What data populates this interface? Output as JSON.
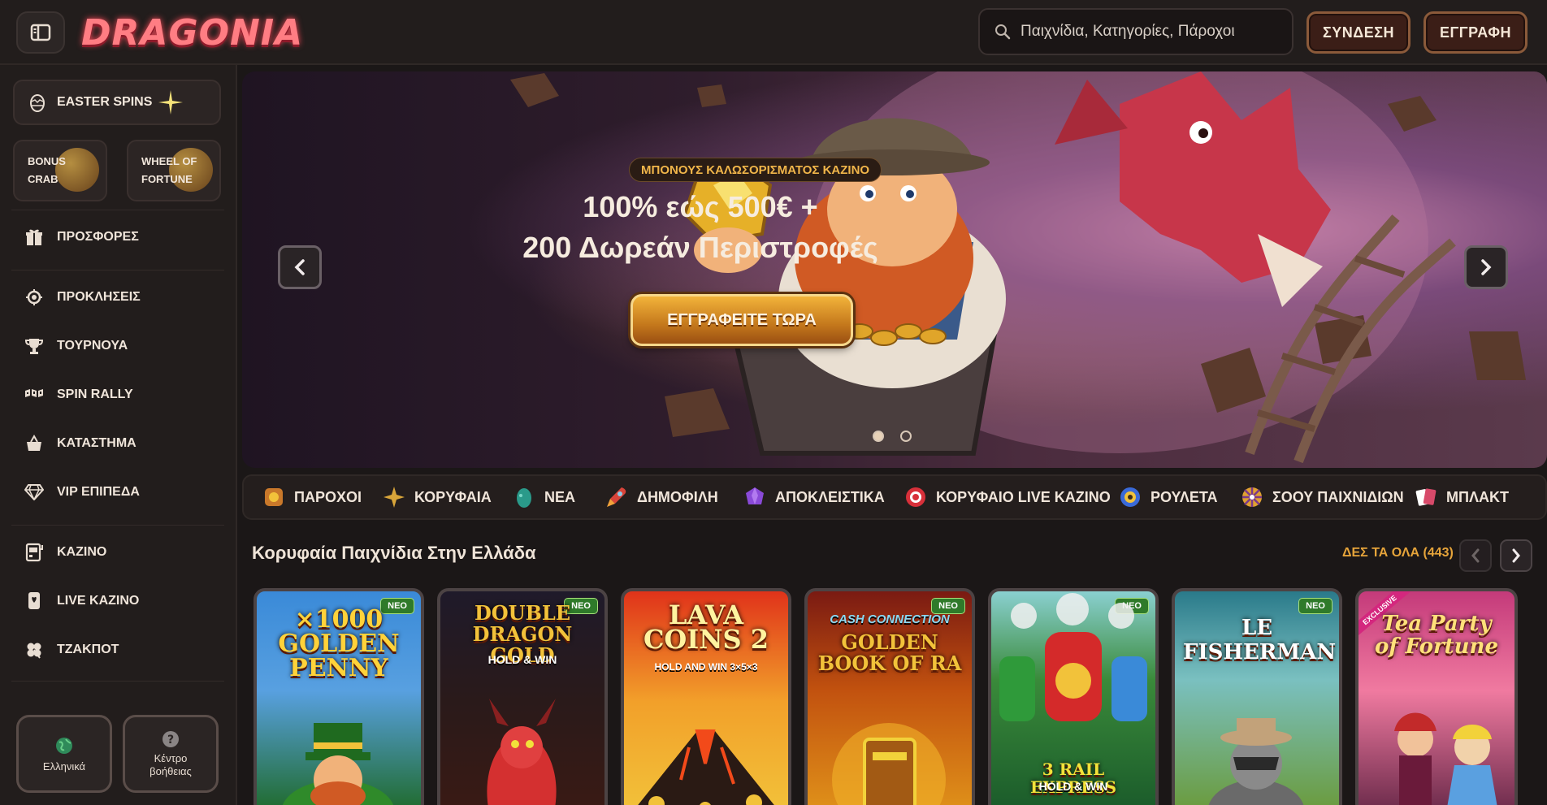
{
  "header": {
    "logo": "DRAGONIA",
    "search_placeholder": "Παιχνίδια, Κατηγορίες, Πάροχοι",
    "login_label": "ΣΥΝΔΕΣΗ",
    "register_label": "ΕΓΓΡΑΦΗ"
  },
  "sidebar": {
    "promo_wide": "EASTER SPINS",
    "promo_left": [
      "BONUS",
      "CRAB"
    ],
    "promo_right": [
      "WHEEL OF",
      "FORTUNE"
    ],
    "items": [
      {
        "label": "ΠΡΟΣΦΟΡΕΣ",
        "icon": "gift-icon"
      },
      {
        "label": "ΠΡΟΚΛΗΣΕΙΣ",
        "icon": "challenge-icon"
      },
      {
        "label": "ΤΟΥΡΝΟΥΑ",
        "icon": "trophy-icon"
      },
      {
        "label": "SPIN RALLY",
        "icon": "rally-flag-icon"
      },
      {
        "label": "ΚΑΤΑΣΤΗΜΑ",
        "icon": "shop-basket-icon"
      },
      {
        "label": "VIP ΕΠΙΠΕΔΑ",
        "icon": "diamond-icon"
      },
      {
        "label": "ΚΑΖΙΝΟ",
        "icon": "slot-machine-icon"
      },
      {
        "label": "LIVE ΚΑΖΙΝΟ",
        "icon": "live-cards-icon"
      },
      {
        "label": "ΤΖΑΚΠΟΤ",
        "icon": "clover-icon"
      }
    ],
    "language_label": "Ελληνικά",
    "help_label_1": "Κέντρο",
    "help_label_2": "βοήθειας"
  },
  "hero": {
    "badge": "ΜΠΟΝΟΥΣ ΚΑΛΩΣΟΡΙΣΜΑΤΟΣ ΚΑΖΙΝΟ",
    "line1": "100% εώς 500€ +",
    "line2": "200 Δωρεάν Περιστροφές",
    "cta": "ΕΓΓΡΑΦΕΙΤΕ ΤΩΡΑ",
    "slide_count": 2,
    "active_slide": 1
  },
  "categories": [
    {
      "label": "ΠΑΡΟΧΟΙ",
      "icon": "providers-icon",
      "color": "#c9782a"
    },
    {
      "label": "ΚΟΡΥΦΑΙΑ",
      "icon": "star-icon",
      "color": "#d8a53a"
    },
    {
      "label": "ΝΕΑ",
      "icon": "egg-icon",
      "color": "#2a9a8a"
    },
    {
      "label": "ΔΗΜΟΦΙΛΗ",
      "icon": "rocket-icon",
      "color": "#d8443a"
    },
    {
      "label": "ΑΠΟΚΛΕΙΣΤΙΚΑ",
      "icon": "gem-icon",
      "color": "#8a4ad8"
    },
    {
      "label": "ΚΟΡΥΦΑΙΟ LIVE ΚΑΖΙΝΟ",
      "icon": "chip-icon",
      "color": "#d8303a"
    },
    {
      "label": "ΡΟΥΛΕΤΑ",
      "icon": "roulette-icon",
      "color": "#3a6ad8"
    },
    {
      "label": "ΣΟΟΥ ΠΑΙΧΝΙΔΙΩΝ",
      "icon": "wheel-icon",
      "color": "#e0a030"
    },
    {
      "label": "ΜΠΛΑΚΤ",
      "icon": "cards-icon",
      "color": "#d84a6a"
    }
  ],
  "section": {
    "title": "Κορυφαία Παιχνίδια Στην Ελλάδα",
    "see_all": "ΔΕΣ ΤΑ ΟΛΑ (443)"
  },
  "games": [
    {
      "title": "×1000 GOLDEN PENNY",
      "sub": "",
      "badge": "ΝΕΟ",
      "bg1": "#3a8ad8",
      "bg2": "#1f6a2a"
    },
    {
      "title": "DOUBLE DRAGON GOLD",
      "sub": "HOLD & WIN",
      "badge": "ΝΕΟ",
      "bg1": "#1f1a2a",
      "bg2": "#3a1a14"
    },
    {
      "title": "LAVA COINS 2",
      "sub": "HOLD AND WIN 3×5×3",
      "badge": "",
      "bg1": "#e0331a",
      "bg2": "#f2c23a"
    },
    {
      "title": "GOLDEN BOOK OF RA",
      "sub": "CASH CONNECTION",
      "badge": "ΝΕΟ",
      "bg1": "#7a1a12",
      "bg2": "#e0921a"
    },
    {
      "title": "3 RAIL EXPRESS",
      "sub": "HOLD & WIN",
      "badge": "ΝΕΟ",
      "bg1": "#3a8a3a",
      "bg2": "#1a5a2a"
    },
    {
      "title": "LE FISHERMAN",
      "sub": "",
      "badge": "ΝΕΟ",
      "bg1": "#2a7a8a",
      "bg2": "#6a9a3a"
    },
    {
      "title": "Tea Party of Fortune",
      "sub": "EXCLUSIVE",
      "badge": "",
      "bg1": "#c43a7a",
      "bg2": "#6a2a4a"
    }
  ],
  "colors": {
    "accent_orange": "#e6a43a",
    "badge_green": "#2f7a2a",
    "hero_cta": "#f2b33a"
  }
}
